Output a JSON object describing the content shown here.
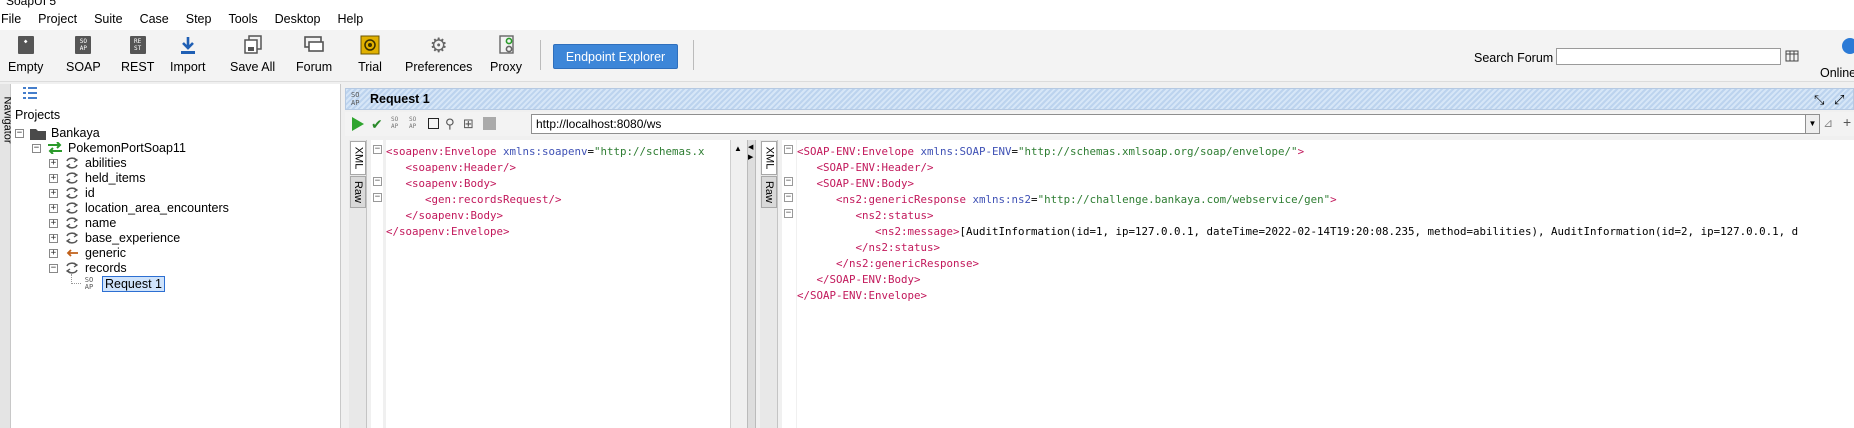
{
  "window": {
    "title": "SoapUI 5"
  },
  "menu": [
    "File",
    "Project",
    "Suite",
    "Case",
    "Step",
    "Tools",
    "Desktop",
    "Help"
  ],
  "toolbar": {
    "buttons": [
      {
        "label": "Empty",
        "icon": "empty-project-icon"
      },
      {
        "label": "SOAP",
        "icon": "soap-icon"
      },
      {
        "label": "REST",
        "icon": "rest-icon"
      },
      {
        "label": "Import",
        "icon": "import-icon"
      },
      {
        "label": "Save All",
        "icon": "save-all-icon"
      },
      {
        "label": "Forum",
        "icon": "forum-icon"
      },
      {
        "label": "Trial",
        "icon": "trial-icon"
      },
      {
        "label": "Preferences",
        "icon": "gear-icon"
      },
      {
        "label": "Proxy",
        "icon": "proxy-icon"
      }
    ],
    "endpoint_explorer": "Endpoint Explorer",
    "search_label": "Search Forum",
    "search_value": "",
    "online_label": "Online"
  },
  "navigator": {
    "tab_label": "Navigator",
    "projects_label": "Projects",
    "tree": [
      {
        "label": "Bankaya",
        "type": "folder"
      },
      {
        "label": "PokemonPortSoap11",
        "type": "interface"
      },
      {
        "label": "abilities",
        "type": "operation"
      },
      {
        "label": "held_items",
        "type": "operation"
      },
      {
        "label": "id",
        "type": "operation"
      },
      {
        "label": "location_area_encounters",
        "type": "operation"
      },
      {
        "label": "name",
        "type": "operation"
      },
      {
        "label": "base_experience",
        "type": "operation"
      },
      {
        "label": "generic",
        "type": "operation-in"
      },
      {
        "label": "records",
        "type": "operation"
      },
      {
        "label": "Request 1",
        "type": "request",
        "selected": true
      }
    ]
  },
  "request": {
    "title": "Request 1",
    "endpoint": "http://localhost:8080/ws",
    "request_tabs": [
      "XML",
      "Raw"
    ],
    "response_tabs": [
      "XML",
      "Raw"
    ],
    "request_xml": [
      [
        {
          "c": "tag",
          "t": "<soapenv:Envelope "
        },
        {
          "c": "attr",
          "t": "xmlns:soapenv"
        },
        {
          "c": "txt",
          "t": "="
        },
        {
          "c": "val",
          "t": "\"http://schemas.x"
        }
      ],
      [
        {
          "c": "txt",
          "t": "   "
        },
        {
          "c": "tag",
          "t": "<soapenv:Header/>"
        }
      ],
      [
        {
          "c": "txt",
          "t": "   "
        },
        {
          "c": "tag",
          "t": "<soapenv:Body>"
        }
      ],
      [
        {
          "c": "txt",
          "t": "      "
        },
        {
          "c": "tag",
          "t": "<gen:recordsRequest/>"
        }
      ],
      [
        {
          "c": "txt",
          "t": "   "
        },
        {
          "c": "tag",
          "t": "</soapenv:Body>"
        }
      ],
      [
        {
          "c": "tag",
          "t": "</soapenv:Envelope>"
        }
      ]
    ],
    "response_xml": [
      [
        {
          "c": "tag",
          "t": "<SOAP-ENV:Envelope "
        },
        {
          "c": "attr",
          "t": "xmlns:SOAP-ENV"
        },
        {
          "c": "txt",
          "t": "="
        },
        {
          "c": "val",
          "t": "\"http://schemas.xmlsoap.org/soap/envelope/\""
        },
        {
          "c": "tag",
          "t": ">"
        }
      ],
      [
        {
          "c": "txt",
          "t": "   "
        },
        {
          "c": "tag",
          "t": "<SOAP-ENV:Header/>"
        }
      ],
      [
        {
          "c": "txt",
          "t": "   "
        },
        {
          "c": "tag",
          "t": "<SOAP-ENV:Body>"
        }
      ],
      [
        {
          "c": "txt",
          "t": "      "
        },
        {
          "c": "tag",
          "t": "<ns2:genericResponse "
        },
        {
          "c": "attr",
          "t": "xmlns:ns2"
        },
        {
          "c": "txt",
          "t": "="
        },
        {
          "c": "val",
          "t": "\"http://challenge.bankaya.com/webservice/gen\""
        },
        {
          "c": "tag",
          "t": ">"
        }
      ],
      [
        {
          "c": "txt",
          "t": "         "
        },
        {
          "c": "tag",
          "t": "<ns2:status>"
        }
      ],
      [
        {
          "c": "txt",
          "t": "            "
        },
        {
          "c": "tag",
          "t": "<ns2:message>"
        },
        {
          "c": "txt",
          "t": "[AuditInformation(id=1, ip=127.0.0.1, dateTime=2022-02-14T19:20:08.235, method=abilities), AuditInformation(id=2, ip=127.0.0.1, d"
        }
      ],
      [
        {
          "c": "txt",
          "t": "         "
        },
        {
          "c": "tag",
          "t": "</ns2:status>"
        }
      ],
      [
        {
          "c": "txt",
          "t": "      "
        },
        {
          "c": "tag",
          "t": "</ns2:genericResponse>"
        }
      ],
      [
        {
          "c": "txt",
          "t": "   "
        },
        {
          "c": "tag",
          "t": "</SOAP-ENV:Body>"
        }
      ],
      [
        {
          "c": "tag",
          "t": "</SOAP-ENV:Envelope>"
        }
      ]
    ]
  },
  "colors": {
    "accent": "#3d86d8",
    "xml_tag": "#c2185b",
    "xml_attr": "#3f51b5",
    "xml_value": "#2e7d32",
    "selection": "#cfe3fb"
  }
}
